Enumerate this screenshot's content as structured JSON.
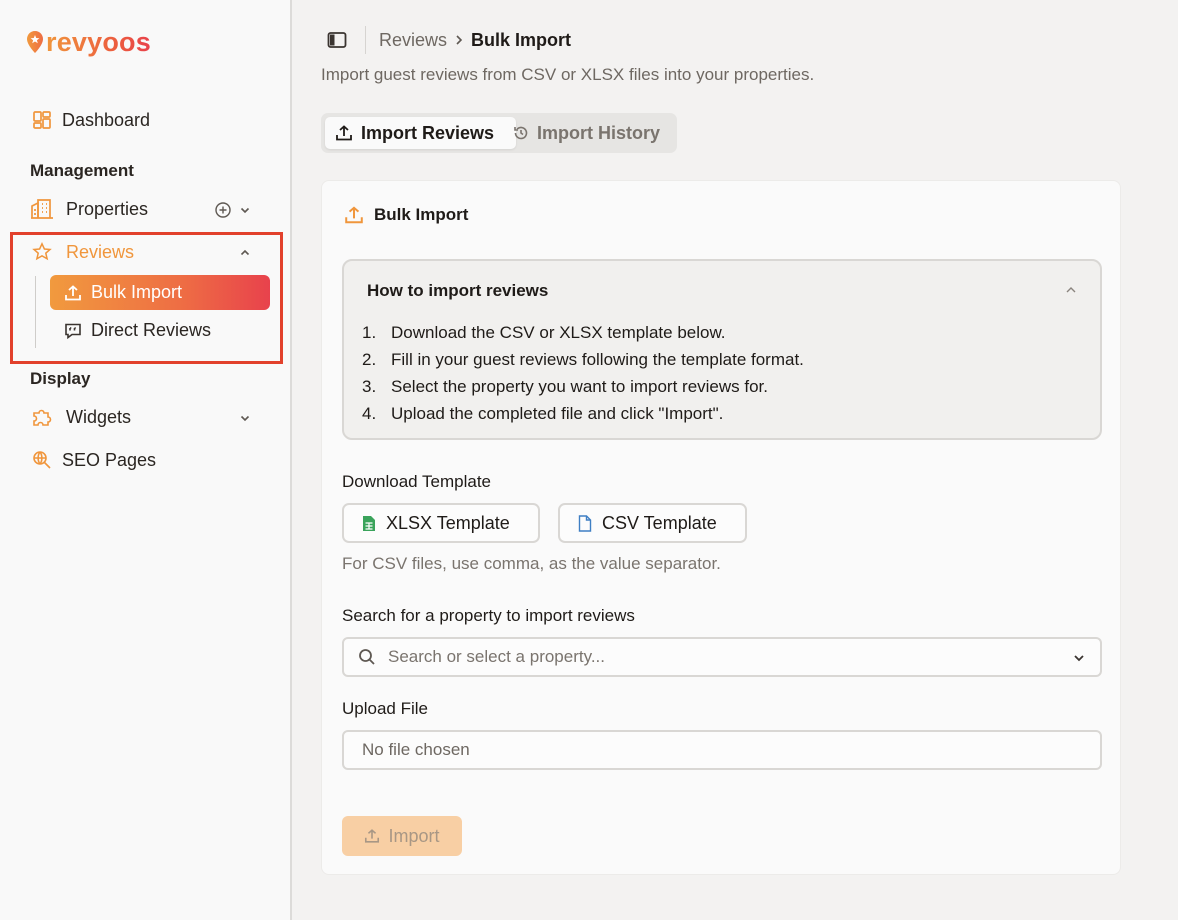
{
  "brand": {
    "logo_text": "revyoos",
    "accent": "#ee6d44",
    "gradient_start": "#f19a3e",
    "gradient_end": "#e8424c"
  },
  "sidebar": {
    "dashboard_label": "Dashboard",
    "management_heading": "Management",
    "properties_label": "Properties",
    "reviews_label": "Reviews",
    "reviews_children": [
      {
        "label": "Bulk Import",
        "active": true
      },
      {
        "label": "Direct Reviews",
        "active": false
      }
    ],
    "display_heading": "Display",
    "widgets_label": "Widgets",
    "seo_label": "SEO Pages"
  },
  "breadcrumb": {
    "parent": "Reviews",
    "current": "Bulk Import"
  },
  "subtitle": "Import guest reviews from CSV or XLSX files into your properties.",
  "tabs": [
    {
      "label": "Import Reviews",
      "active": true
    },
    {
      "label": "Import History",
      "active": false
    }
  ],
  "card": {
    "title": "Bulk Import",
    "howto": {
      "title": "How to import reviews",
      "steps": [
        {
          "num": "1.",
          "text": "Download the CSV or XLSX template below."
        },
        {
          "num": "2.",
          "text": "Fill in your guest reviews following the template format."
        },
        {
          "num": "3.",
          "text": "Select the property you want to import reviews for."
        },
        {
          "num": "4.",
          "text": "Upload the completed file and click \"Import\"."
        }
      ]
    },
    "download_label": "Download Template",
    "xlsx_button": "XLSX Template",
    "csv_button": "CSV Template",
    "csv_hint": "For CSV files, use comma, as the value separator.",
    "search_label": "Search for a property to import reviews",
    "search_placeholder": "Search or select a property...",
    "upload_label": "Upload File",
    "file_status": "No file chosen",
    "import_button": "Import"
  }
}
